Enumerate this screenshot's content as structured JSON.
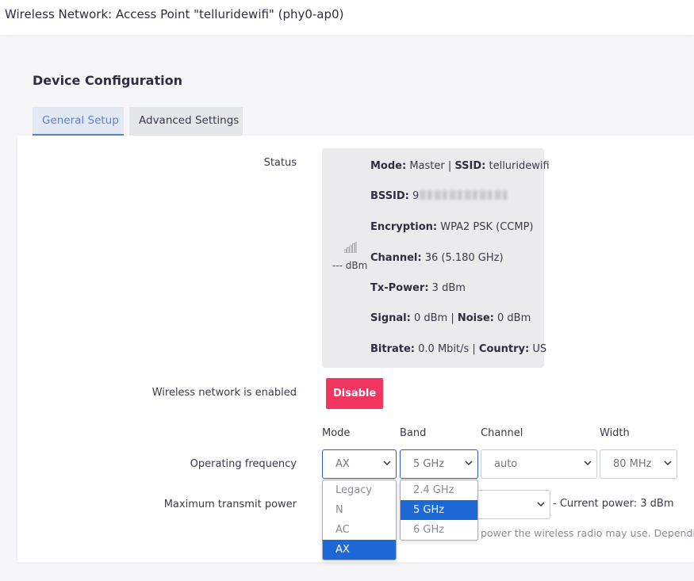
{
  "window": {
    "title": "Wireless Network: Access Point \"telluridewifi\" (phy0-ap0)"
  },
  "section": {
    "title": "Device Configuration"
  },
  "tabs": [
    {
      "label": "General Setup",
      "active": true
    },
    {
      "label": "Advanced Settings",
      "active": false
    }
  ],
  "status": {
    "label": "Status",
    "signal_text": "--- dBm",
    "signal_icon": "signal-bars-icon",
    "mode_key": "Mode:",
    "mode_val": " Master | ",
    "ssid_key": "SSID:",
    "ssid_val": " telluridewifi",
    "bssid_key": "BSSID:",
    "bssid_val": " 9",
    "encryption_key": "Encryption:",
    "encryption_val": " WPA2 PSK (CCMP)",
    "channel_key": "Channel:",
    "channel_val": " 36 (5.180 GHz)",
    "txpower_key": "Tx-Power:",
    "txpower_val": " 3 dBm",
    "signal_key": "Signal:",
    "signal_val": " 0 dBm | ",
    "noise_key": "Noise:",
    "noise_val": " 0 dBm",
    "bitrate_key": "Bitrate:",
    "bitrate_val": " 0.0 Mbit/s | ",
    "country_key": "Country:",
    "country_val": " US"
  },
  "wireless": {
    "label": "Wireless network is enabled",
    "button_label": "Disable",
    "button_color": "#f0355e"
  },
  "frequency": {
    "label": "Operating frequency",
    "mode_header": "Mode",
    "band_header": "Band",
    "channel_header": "Channel",
    "width_header": "Width",
    "mode_value": "AX",
    "band_value": "5 GHz",
    "channel_value": "auto",
    "width_value": "80 MHz",
    "mode_options": [
      "Legacy",
      "N",
      "AC",
      "AX"
    ],
    "band_options": [
      "2.4 GHz",
      "5 GHz",
      "6 GHz"
    ]
  },
  "power": {
    "label": "Maximum transmit power",
    "current": "- Current power: 3 dBm",
    "help": "power the wireless radio may use. Depending o"
  },
  "colors": {
    "accent": "#5b7fd6",
    "selected": "#1b68d6",
    "danger": "#f0355e"
  }
}
